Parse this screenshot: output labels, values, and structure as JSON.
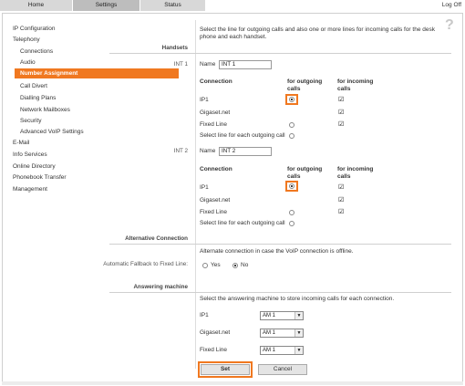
{
  "tabs": [
    {
      "label": "Home"
    },
    {
      "label": "Settings"
    },
    {
      "label": "Status"
    }
  ],
  "logoff": "Log Off",
  "nav": {
    "items": [
      {
        "label": "IP Configuration"
      },
      {
        "label": "Telephony"
      },
      {
        "label": "Connections"
      },
      {
        "label": "Audio"
      },
      {
        "label": "Number Assignment"
      },
      {
        "label": "Call Divert"
      },
      {
        "label": "Dialling Plans"
      },
      {
        "label": "Network Mailboxes"
      },
      {
        "label": "Security"
      },
      {
        "label": "Advanced VoIP Settings"
      },
      {
        "label": "E-Mail"
      },
      {
        "label": "Info Services"
      },
      {
        "label": "Online Directory"
      },
      {
        "label": "Phonebook Transfer"
      },
      {
        "label": "Management"
      }
    ]
  },
  "intro": "Select the line for outgoing calls and also one or more lines for incoming calls for the desk phone and each handset.",
  "section_handsets": "Handsets",
  "int1": {
    "side": "INT 1",
    "name_label": "Name",
    "name_value": "INT 1",
    "col_connection": "Connection",
    "col_outgoing": "for outgoing calls",
    "col_incoming": "for incoming calls",
    "rows": [
      {
        "label": "IP1"
      },
      {
        "label": "Gigaset.net"
      },
      {
        "label": "Fixed Line"
      },
      {
        "label": "Select line for each outgoing call"
      }
    ]
  },
  "int2": {
    "side": "INT 2",
    "name_label": "Name",
    "name_value": "INT 2",
    "col_connection": "Connection",
    "col_outgoing": "for outgoing calls",
    "col_incoming": "for incoming calls",
    "rows": [
      {
        "label": "IP1"
      },
      {
        "label": "Gigaset.net"
      },
      {
        "label": "Fixed Line"
      },
      {
        "label": "Select line for each outgoing call"
      }
    ]
  },
  "alternative": {
    "section": "Alternative Connection",
    "desc": "Alternate connection in case the VoIP connection is offline.",
    "side_label": "Automatic Fallback to Fixed Line:",
    "yes": "Yes",
    "no": "No"
  },
  "answering": {
    "section": "Answering machine",
    "desc": "Select the answering machine to store incoming calls for each connection.",
    "rows": [
      {
        "label": "IP1",
        "value": "AM 1"
      },
      {
        "label": "Gigaset.net",
        "value": "AM 1"
      },
      {
        "label": "Fixed Line",
        "value": "AM 1"
      }
    ]
  },
  "buttons": {
    "set": "Set",
    "cancel": "Cancel"
  },
  "help": "?",
  "colors": {
    "accent": "#f07820"
  }
}
